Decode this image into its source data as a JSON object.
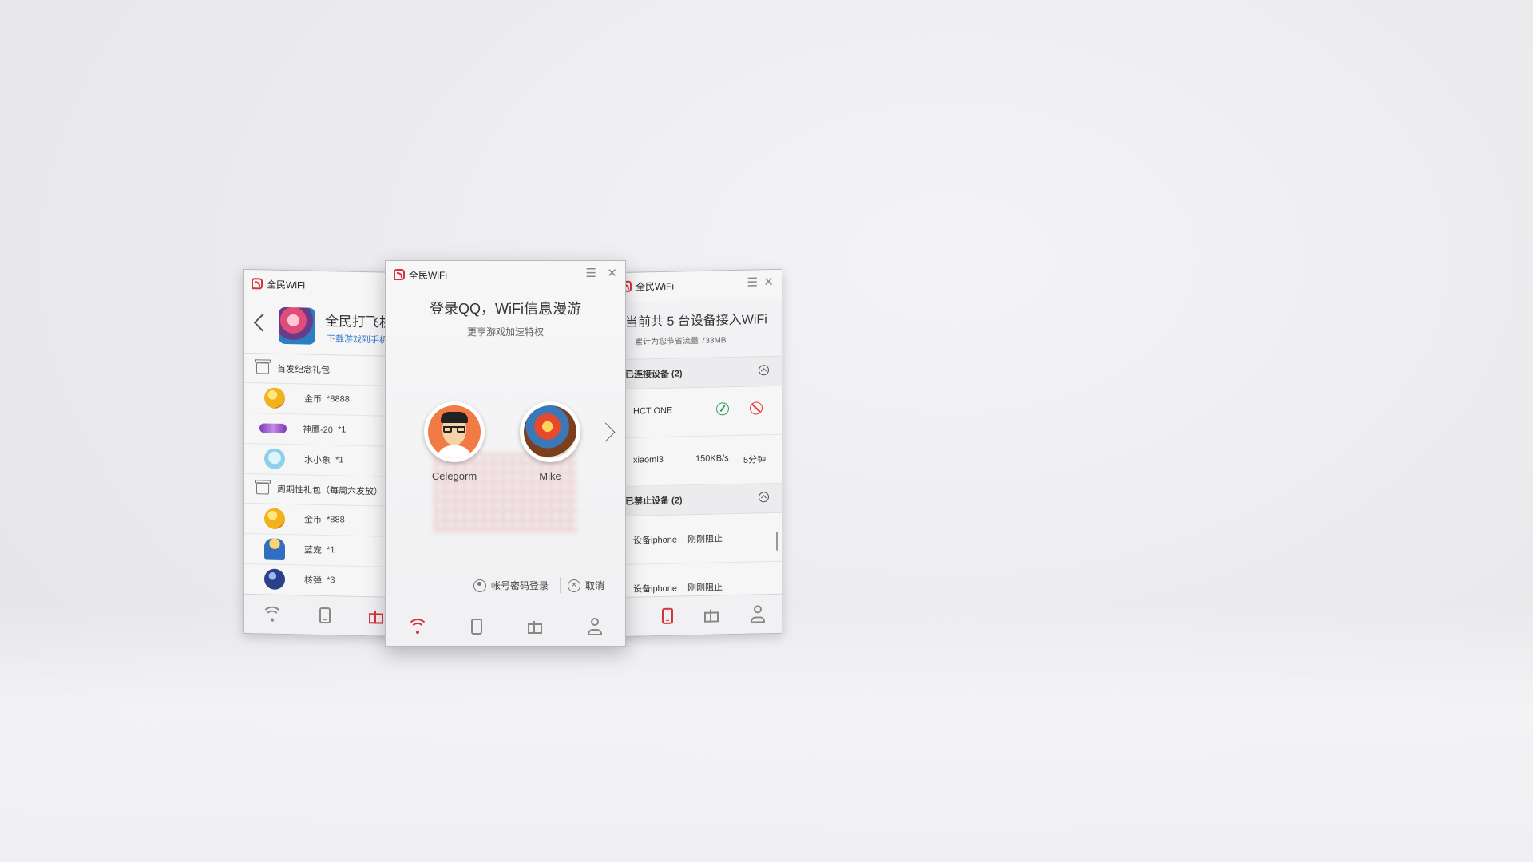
{
  "app": {
    "name": "全民WiFi"
  },
  "left_window": {
    "title": "全民WiFi",
    "game_title": "全民打飞机",
    "game_subtitle": "下载游戏到手机",
    "section1": "首发纪念礼包",
    "section1_items": [
      {
        "name": "金币",
        "qty": "*8888"
      },
      {
        "name": "神鹰-20",
        "qty": "*1"
      },
      {
        "name": "水小象",
        "qty": "*1"
      }
    ],
    "section2": "周期性礼包（每周六发放）",
    "section2_items": [
      {
        "name": "金币",
        "qty": "*888"
      },
      {
        "name": "蓝宠",
        "qty": "*1"
      },
      {
        "name": "核弹",
        "qty": "*3"
      }
    ]
  },
  "center_window": {
    "title": "全民WiFi",
    "heading": "登录QQ，WiFi信息漫游",
    "subheading": "更享游戏加速特权",
    "accounts": [
      {
        "name": "Celegorm"
      },
      {
        "name": "Mike"
      }
    ],
    "password_login": "帐号密码登录",
    "cancel": "取消"
  },
  "right_window": {
    "title": "全民WiFi",
    "heading": "当前共 5 台设备接入WiFi",
    "subheading": "累计为您节省流量 733MB",
    "section_connected": "已连接设备 (2)",
    "connected": [
      {
        "name": "HCT ONE"
      },
      {
        "name": "xiaomi3",
        "speed": "150KB/s",
        "time": "5分钟"
      }
    ],
    "section_blocked": "已禁止设备 (2)",
    "blocked": [
      {
        "name": "设备iphone",
        "status": "刚刚阻止"
      },
      {
        "name": "设备iphone",
        "status": "刚刚阻止"
      }
    ]
  },
  "nav_icons": [
    "wifi-icon",
    "tablet-icon",
    "gift-icon",
    "user-icon"
  ],
  "colors": {
    "accent": "#d8333a",
    "link": "#2f78c8",
    "ok": "#2ba05b"
  }
}
